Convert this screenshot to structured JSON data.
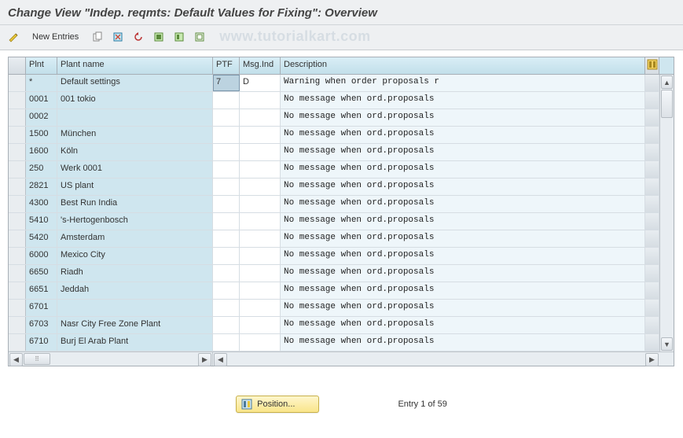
{
  "title": "Change View \"Indep. reqmts: Default Values for Fixing\": Overview",
  "toolbar": {
    "new_entries_label": "New Entries"
  },
  "watermark": "www.tutorialkart.com",
  "columns": {
    "plnt": "Plnt",
    "plant_name": "Plant name",
    "ptf": "PTF",
    "msg_ind": "Msg.Ind",
    "description": "Description"
  },
  "rows": [
    {
      "plnt": "*",
      "name": "Default settings",
      "ptf": "7",
      "msg": "D",
      "desc": "Warning when order proposals r",
      "ptf_focus": true
    },
    {
      "plnt": "0001",
      "name": "001 tokio",
      "ptf": "",
      "msg": "",
      "desc": "No message when ord.proposals"
    },
    {
      "plnt": "0002",
      "name": "",
      "ptf": "",
      "msg": "",
      "desc": "No message when ord.proposals"
    },
    {
      "plnt": "1500",
      "name": "München",
      "ptf": "",
      "msg": "",
      "desc": "No message when ord.proposals"
    },
    {
      "plnt": "1600",
      "name": "Köln",
      "ptf": "",
      "msg": "",
      "desc": "No message when ord.proposals"
    },
    {
      "plnt": "250",
      "name": "Werk 0001",
      "ptf": "",
      "msg": "",
      "desc": "No message when ord.proposals"
    },
    {
      "plnt": "2821",
      "name": "US plant",
      "ptf": "",
      "msg": "",
      "desc": "No message when ord.proposals"
    },
    {
      "plnt": "4300",
      "name": "Best Run India",
      "ptf": "",
      "msg": "",
      "desc": "No message when ord.proposals"
    },
    {
      "plnt": "5410",
      "name": "'s-Hertogenbosch",
      "ptf": "",
      "msg": "",
      "desc": "No message when ord.proposals"
    },
    {
      "plnt": "5420",
      "name": "Amsterdam",
      "ptf": "",
      "msg": "",
      "desc": "No message when ord.proposals"
    },
    {
      "plnt": "6000",
      "name": "Mexico City",
      "ptf": "",
      "msg": "",
      "desc": "No message when ord.proposals"
    },
    {
      "plnt": "6650",
      "name": "Riadh",
      "ptf": "",
      "msg": "",
      "desc": "No message when ord.proposals"
    },
    {
      "plnt": "6651",
      "name": "Jeddah",
      "ptf": "",
      "msg": "",
      "desc": "No message when ord.proposals"
    },
    {
      "plnt": "6701",
      "name": "",
      "ptf": "",
      "msg": "",
      "desc": "No message when ord.proposals"
    },
    {
      "plnt": "6703",
      "name": "Nasr City Free Zone Plant",
      "ptf": "",
      "msg": "",
      "desc": "No message when ord.proposals"
    },
    {
      "plnt": "6710",
      "name": "Burj El Arab Plant",
      "ptf": "",
      "msg": "",
      "desc": "No message when ord.proposals"
    }
  ],
  "footer": {
    "position_label": "Position...",
    "entry_text": "Entry 1 of 59"
  }
}
